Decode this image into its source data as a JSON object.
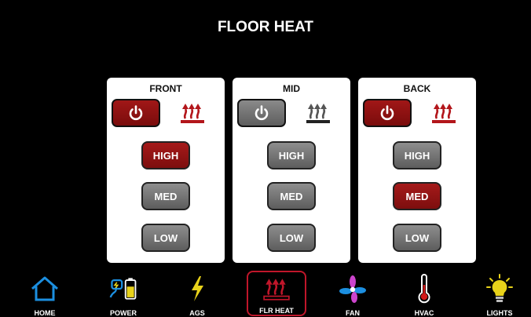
{
  "title": "FLOOR HEAT",
  "zones": [
    {
      "name": "FRONT",
      "power": "on",
      "levels": [
        {
          "label": "HIGH",
          "selected": true
        },
        {
          "label": "MED",
          "selected": false
        },
        {
          "label": "LOW",
          "selected": false
        }
      ]
    },
    {
      "name": "MID",
      "power": "off",
      "levels": [
        {
          "label": "HIGH",
          "selected": false
        },
        {
          "label": "MED",
          "selected": false
        },
        {
          "label": "LOW",
          "selected": false
        }
      ]
    },
    {
      "name": "BACK",
      "power": "on",
      "levels": [
        {
          "label": "HIGH",
          "selected": false
        },
        {
          "label": "MED",
          "selected": true
        },
        {
          "label": "LOW",
          "selected": false
        }
      ]
    }
  ],
  "nav": [
    {
      "label": "HOME",
      "icon": "home-icon"
    },
    {
      "label": "POWER",
      "icon": "power-battery-icon"
    },
    {
      "label": "AGS",
      "icon": "lightning-icon"
    },
    {
      "label": "FLR HEAT",
      "icon": "floor-heat-icon",
      "active": true
    },
    {
      "label": "FAN",
      "icon": "fan-icon"
    },
    {
      "label": "HVAC",
      "icon": "thermometer-icon"
    },
    {
      "label": "LIGHTS",
      "icon": "lightbulb-icon"
    }
  ],
  "colors": {
    "accent_red": "#a11717",
    "button_gray": "#7a7a7a",
    "nav_active_border": "#c0162a"
  }
}
